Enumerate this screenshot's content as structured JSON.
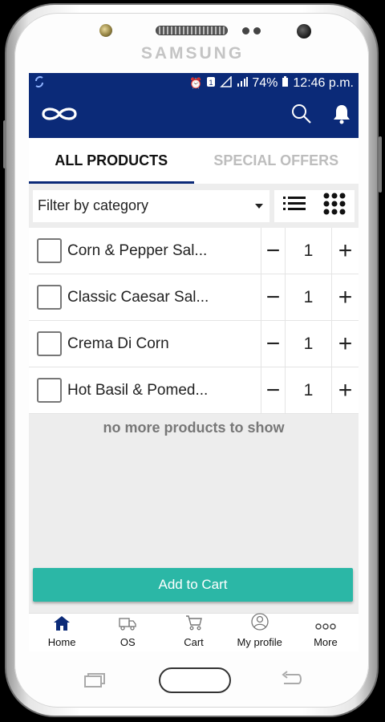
{
  "device": {
    "brand": "SAMSUNG"
  },
  "status_bar": {
    "battery": "74%",
    "time": "12:46 p.m."
  },
  "tabs": [
    {
      "label": "ALL PRODUCTS",
      "active": true
    },
    {
      "label": "SPECIAL OFFERS",
      "active": false
    }
  ],
  "filter": {
    "value": "Filter by category"
  },
  "products": [
    {
      "name": "Corn & Pepper Sal...",
      "qty": "1"
    },
    {
      "name": "Classic Caesar Sal...",
      "qty": "1"
    },
    {
      "name": "Crema Di Corn",
      "qty": "1"
    },
    {
      "name": "Hot Basil & Pomed...",
      "qty": "1"
    }
  ],
  "list_footer": "no more products to show",
  "cart_button": "Add to Cart",
  "bottom_nav": [
    {
      "label": "Home",
      "icon": "home-icon",
      "active": true
    },
    {
      "label": "OS",
      "icon": "truck-icon",
      "active": false
    },
    {
      "label": "Cart",
      "icon": "cart-icon",
      "active": false
    },
    {
      "label": "My profile",
      "icon": "profile-icon",
      "active": false
    },
    {
      "label": "More",
      "icon": "more-icon",
      "active": false
    }
  ],
  "colors": {
    "primary": "#0b2a78",
    "accent": "#2bb7a6"
  }
}
